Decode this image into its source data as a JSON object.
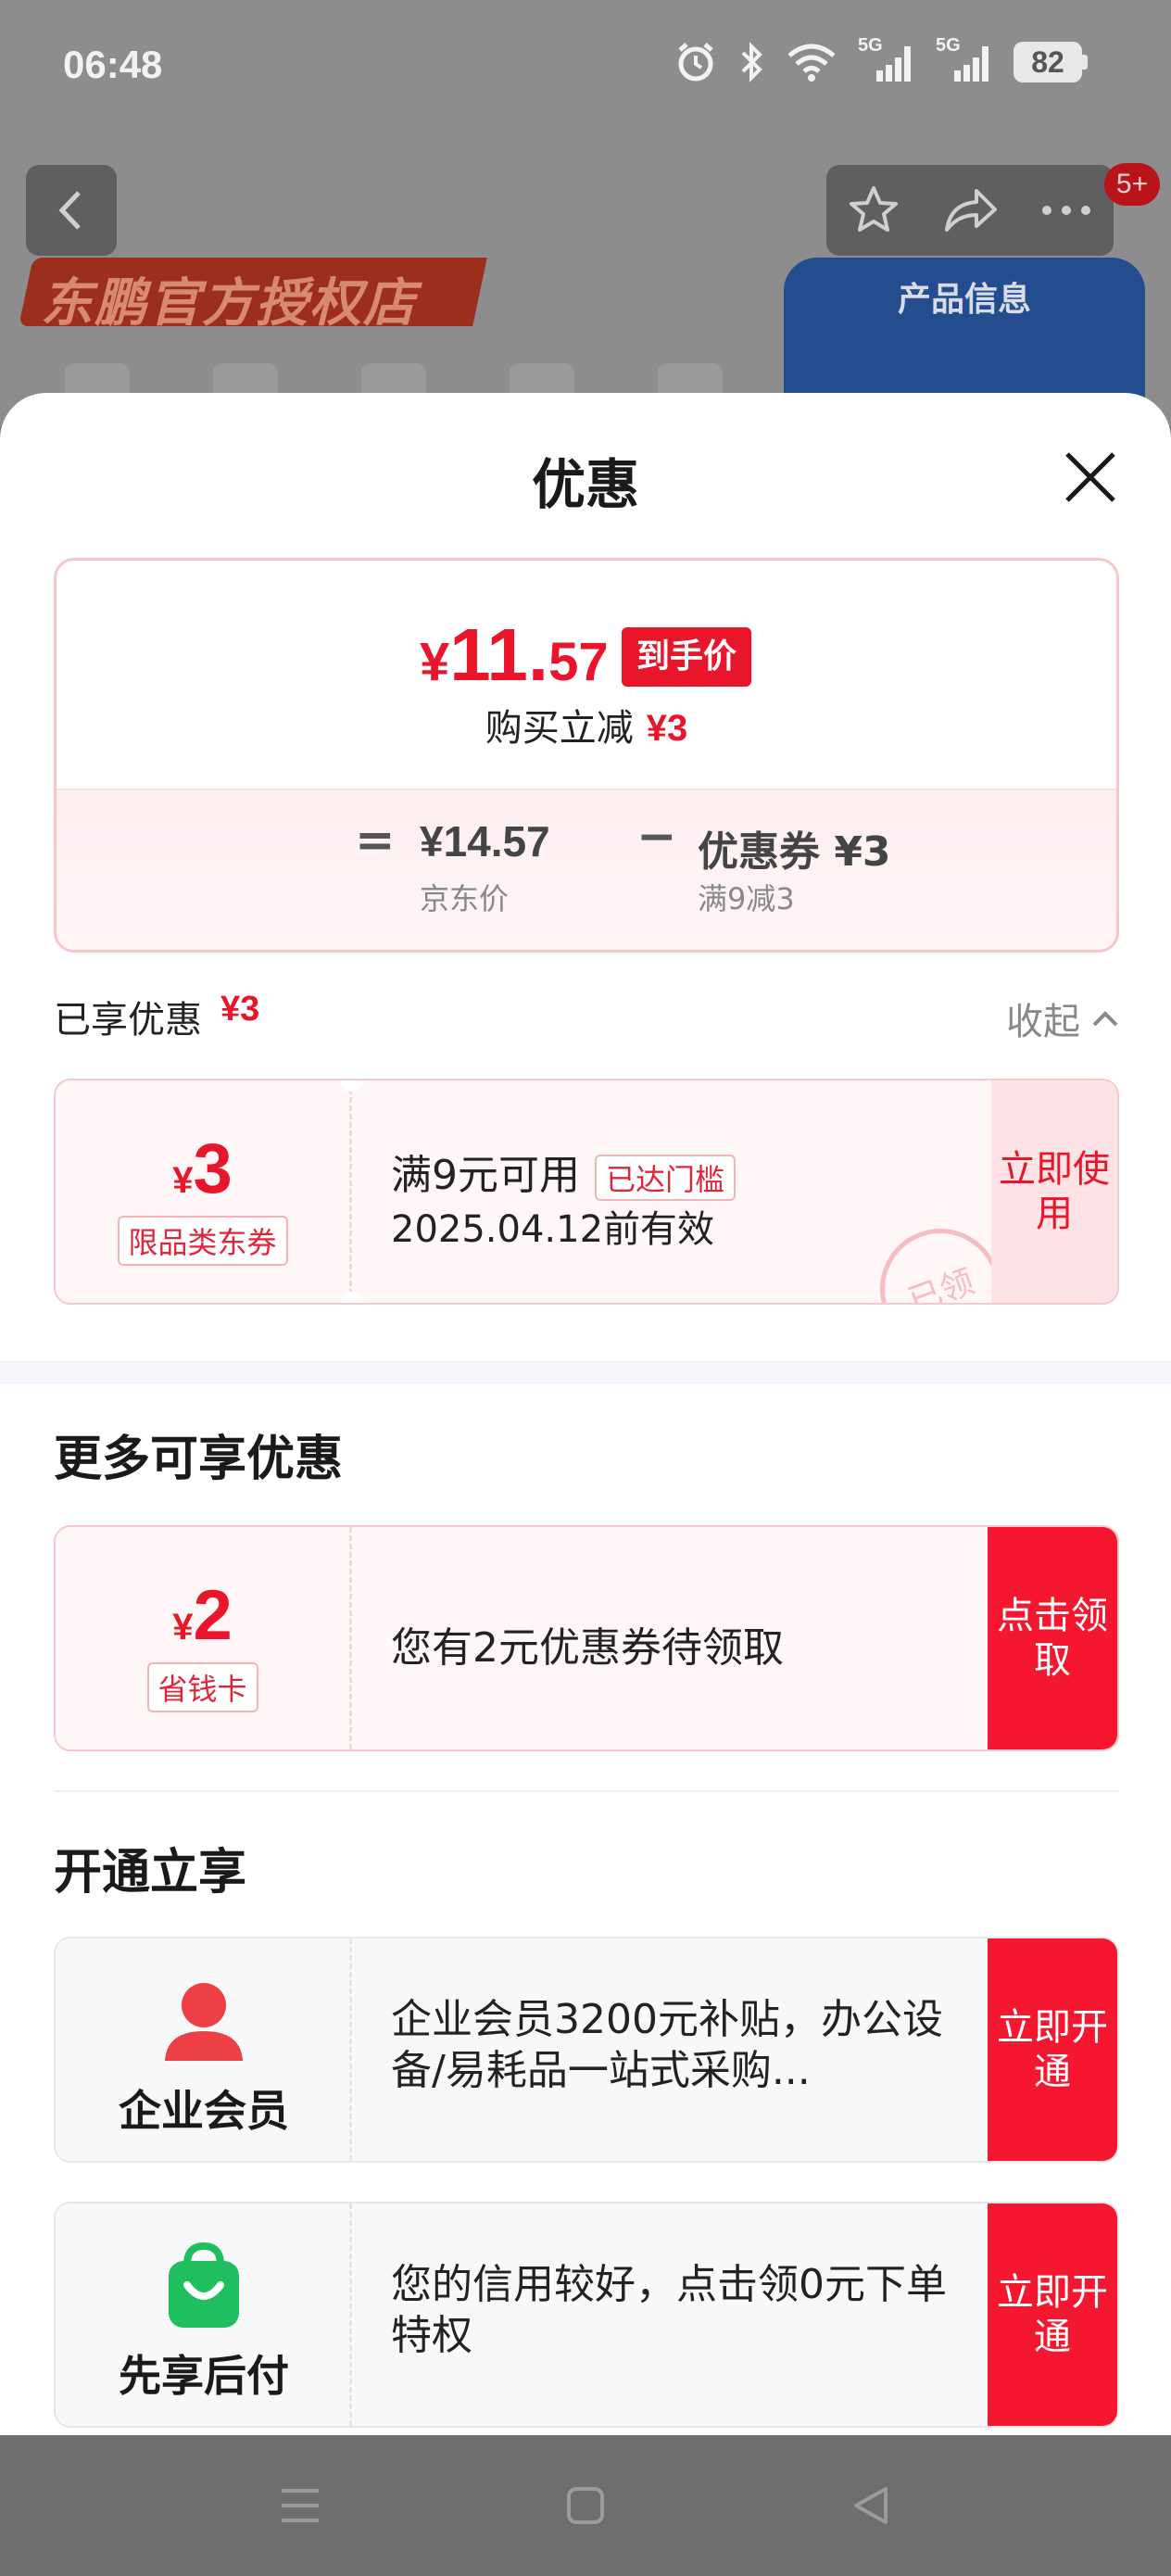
{
  "status_bar": {
    "time": "06:48",
    "battery": "82",
    "network_label_1": "5G",
    "network_label_2": "5G"
  },
  "background_page": {
    "shop_name": "东鹏官方授权店",
    "product_card_title": "产品信息",
    "message_badge": "5+"
  },
  "sheet": {
    "title": "优惠",
    "summary": {
      "currency": "¥",
      "final_price_int": "11.",
      "final_price_dec": "57",
      "hand_price_tag": "到手价",
      "instant_reduce_label": "购买立减",
      "instant_reduce_amount": "¥3",
      "equals": "=",
      "jd_price": "¥14.57",
      "jd_price_label": "京东价",
      "minus": "−",
      "coupon_amount": "优惠券 ¥3",
      "coupon_condition": "满9减3"
    },
    "enjoyed": {
      "label": "已享优惠",
      "amount": "¥3",
      "collapse_label": "收起"
    },
    "enjoyed_coupon": {
      "currency": "¥",
      "amount": "3",
      "tag": "限品类东券",
      "title": "满9元可用",
      "reached_tag": "已达门槛",
      "validity": "2025.04.12前有效",
      "button": "立即使用",
      "stamp": "已领"
    },
    "more_section_title": "更多可享优惠",
    "savings_card": {
      "currency": "¥",
      "amount": "2",
      "tag": "省钱卡",
      "desc": "您有2元优惠券待领取",
      "button": "点击领取"
    },
    "open_section_title": "开通立享",
    "benefits": [
      {
        "name": "企业会员",
        "desc": "企业会员3200元补贴，办公设备/易耗品一站式采购...",
        "button": "立即开通"
      },
      {
        "name": "先享后付",
        "desc": "您的信用较好，点击领0元下单特权",
        "button": "立即开通"
      }
    ]
  },
  "colors": {
    "accent_red": "#e8152b",
    "button_red": "#f5172f",
    "enterprise_icon": "#ec3f46",
    "pay_later_icon": "#1fbf5f"
  },
  "icons": [
    "back-icon",
    "star-icon",
    "share-icon",
    "more-icon",
    "close-icon",
    "chevron-up-icon",
    "person-icon",
    "shopping-bag-icon",
    "menu-icon",
    "home-icon",
    "back-triangle-icon",
    "alarm-icon",
    "bluetooth-icon",
    "wifi-icon",
    "signal-icon",
    "battery-icon"
  ]
}
